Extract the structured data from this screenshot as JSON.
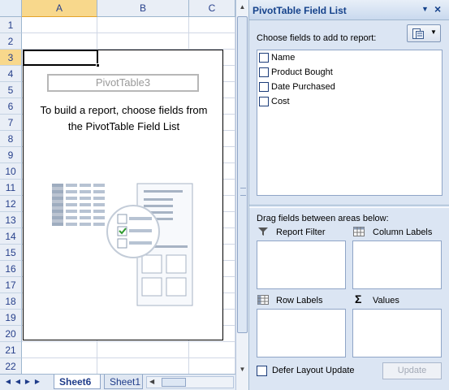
{
  "sheet": {
    "columns": [
      {
        "label": "A",
        "selected": true
      },
      {
        "label": "B",
        "selected": false
      },
      {
        "label": "C",
        "selected": false
      }
    ],
    "rows": [
      "1",
      "2",
      "3",
      "4",
      "5",
      "6",
      "7",
      "8",
      "9",
      "10",
      "11",
      "12",
      "13",
      "14",
      "15",
      "16",
      "17",
      "18",
      "19",
      "20",
      "21",
      "22"
    ],
    "selected_row": "3"
  },
  "pivot": {
    "name": "PivotTable3",
    "message_line1": "To build a report, choose fields from",
    "message_line2": "the PivotTable Field List"
  },
  "tabs": {
    "active": "Sheet6",
    "other": "Sheet1"
  },
  "pane": {
    "title": "PivotTable Field List",
    "choose_label": "Choose fields to add to report:",
    "fields": [
      {
        "label": "Name",
        "checked": false
      },
      {
        "label": "Product Bought",
        "checked": false
      },
      {
        "label": "Date Purchased",
        "checked": false
      },
      {
        "label": "Cost",
        "checked": false
      }
    ],
    "drag_label": "Drag fields between areas below:",
    "areas": {
      "report_filter": "Report Filter",
      "column_labels": "Column Labels",
      "row_labels": "Row Labels",
      "values": "Values"
    },
    "defer_label": "Defer Layout Update",
    "update_label": "Update"
  },
  "colors": {
    "selected_header": "#f8d88c",
    "header_bg": "#e9eef6",
    "pane_bg": "#dbe5f3",
    "title_text": "#15428b"
  }
}
